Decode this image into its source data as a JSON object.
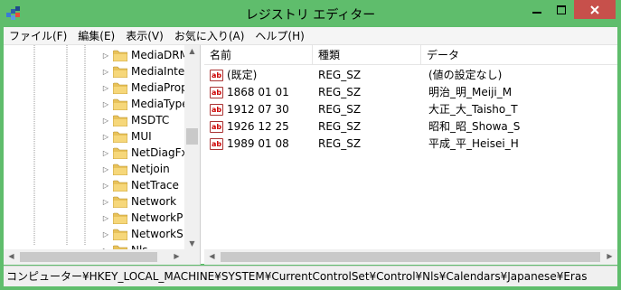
{
  "window": {
    "title": "レジストリ エディター"
  },
  "colors": {
    "frame": "#5fbd6c",
    "close_button": "#c7504b",
    "folder": "#e8c25a"
  },
  "menubar": {
    "items": [
      {
        "label": "ファイル(F)",
        "name": "menu-file"
      },
      {
        "label": "編集(E)",
        "name": "menu-edit"
      },
      {
        "label": "表示(V)",
        "name": "menu-view"
      },
      {
        "label": "お気に入り(A)",
        "name": "menu-favorites"
      },
      {
        "label": "ヘルプ(H)",
        "name": "menu-help"
      }
    ]
  },
  "tree": {
    "items": [
      {
        "label": "MediaDRM",
        "expander": "▷"
      },
      {
        "label": "MediaInte",
        "expander": "▷"
      },
      {
        "label": "MediaProp",
        "expander": "▷"
      },
      {
        "label": "MediaType",
        "expander": "▷"
      },
      {
        "label": "MSDTC",
        "expander": "▷"
      },
      {
        "label": "MUI",
        "expander": "▷"
      },
      {
        "label": "NetDiagFx",
        "expander": "▷"
      },
      {
        "label": "Netjoin",
        "expander": "▷"
      },
      {
        "label": "NetTrace",
        "expander": "▷"
      },
      {
        "label": "Network",
        "expander": "▷"
      },
      {
        "label": "NetworkP",
        "expander": "▷"
      },
      {
        "label": "NetworkS",
        "expander": "▷"
      },
      {
        "label": "Nls",
        "expander": "▷"
      }
    ]
  },
  "list": {
    "columns": [
      "名前",
      "種類",
      "データ"
    ],
    "rows": [
      {
        "icon": "ab",
        "name": "(既定)",
        "type": "REG_SZ",
        "data": "(値の設定なし)"
      },
      {
        "icon": "ab",
        "name": "1868 01 01",
        "type": "REG_SZ",
        "data": "明治_明_Meiji_M"
      },
      {
        "icon": "ab",
        "name": "1912 07 30",
        "type": "REG_SZ",
        "data": "大正_大_Taisho_T"
      },
      {
        "icon": "ab",
        "name": "1926 12 25",
        "type": "REG_SZ",
        "data": "昭和_昭_Showa_S"
      },
      {
        "icon": "ab",
        "name": "1989 01 08",
        "type": "REG_SZ",
        "data": "平成_平_Heisei_H"
      }
    ]
  },
  "statusbar": {
    "path": "コンピューター¥HKEY_LOCAL_MACHINE¥SYSTEM¥CurrentControlSet¥Control¥Nls¥Calendars¥Japanese¥Eras"
  }
}
